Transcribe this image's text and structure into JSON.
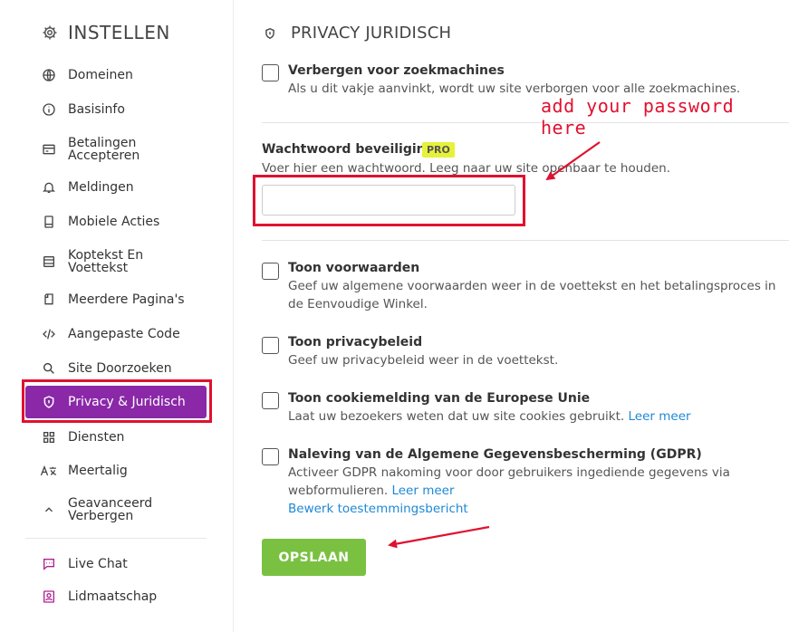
{
  "sidebar": {
    "title": "INSTELLEN",
    "items": [
      {
        "label": "Domeinen",
        "icon": "globe-icon"
      },
      {
        "label": "Basisinfo",
        "icon": "info-icon"
      },
      {
        "label": "Betalingen\nAccepteren",
        "icon": "payment-icon"
      },
      {
        "label": "Meldingen",
        "icon": "bell-icon"
      },
      {
        "label": "Mobiele Acties",
        "icon": "mobile-icon"
      },
      {
        "label": "Koptekst En\nVoettekst",
        "icon": "header-footer-icon"
      },
      {
        "label": "Meerdere Pagina's",
        "icon": "pages-icon"
      },
      {
        "label": "Aangepaste Code",
        "icon": "code-icon"
      },
      {
        "label": "Site Doorzoeken",
        "icon": "search-icon"
      },
      {
        "label": "Privacy & Juridisch",
        "icon": "shield-icon",
        "active": true
      },
      {
        "label": "Diensten",
        "icon": "grid-icon"
      },
      {
        "label": "Meertalig",
        "icon": "translate-icon"
      },
      {
        "label": "Geavanceerd\nVerbergen",
        "icon": "chevron-up-icon"
      }
    ],
    "extra": [
      {
        "label": "Live Chat",
        "icon": "chat-icon"
      },
      {
        "label": "Lidmaatschap",
        "icon": "membership-icon"
      }
    ]
  },
  "main": {
    "title": "PRIVACY JURIDISCH",
    "hide_search": {
      "title": "Verbergen voor zoekmachines",
      "desc": "Als u dit vakje aanvinkt, wordt uw site verborgen voor alle zoekmachines."
    },
    "password": {
      "label": "Wachtwoord beveiliging",
      "badge": "PRO",
      "desc": "Voer hier een wachtwoord. Leeg naar uw site openbaar te houden.",
      "value": ""
    },
    "terms": {
      "title": "Toon voorwaarden",
      "desc": "Geef uw algemene voorwaarden weer in de voettekst en het betalingsproces in de Eenvoudige Winkel."
    },
    "privacy_policy": {
      "title": "Toon privacybeleid",
      "desc": "Geef uw privacybeleid weer in de voettekst."
    },
    "cookie": {
      "title": "Toon cookiemelding van de Europese Unie",
      "desc": "Laat uw bezoekers weten dat uw site cookies gebruikt.",
      "link": "Leer meer"
    },
    "gdpr": {
      "title": "Naleving van de Algemene Gegevensbescherming (GDPR)",
      "desc_line1": "Activeer GDPR nakoming voor door gebruikers ingediende gegevens via",
      "desc_line2": "webformulieren.",
      "link": "Leer meer",
      "edit_link": "Bewerk toestemmingsbericht"
    },
    "save_label": "OPSLAAN"
  },
  "annotation": {
    "text": "add your password here",
    "color": "#e0112f"
  },
  "colors": {
    "active_nav": "#8a28a8",
    "save_button": "#7ac142",
    "pro_badge": "#e6f23a",
    "link": "#1e88d4"
  }
}
